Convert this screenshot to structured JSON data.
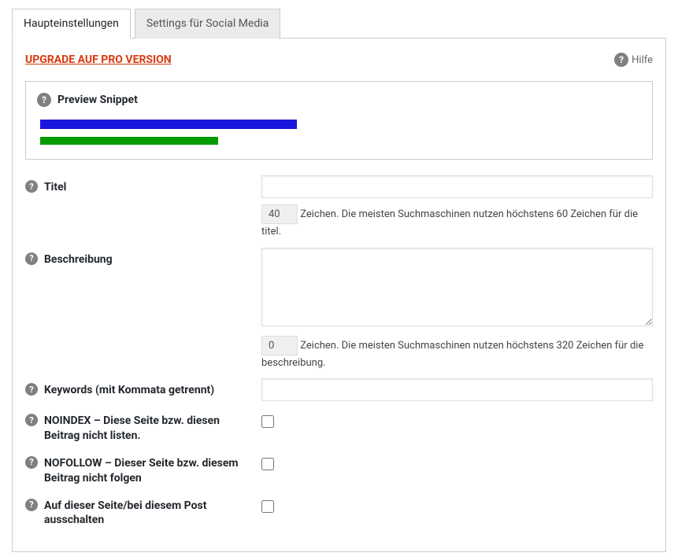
{
  "tabs": {
    "items": [
      {
        "label": "Haupteinstellungen",
        "active": true
      },
      {
        "label": "Settings für Social Media",
        "active": false
      }
    ]
  },
  "top": {
    "upgrade_label": "UPGRADE AUF PRO VERSION",
    "help_label": "Hilfe"
  },
  "preview": {
    "heading": "Preview Snippet"
  },
  "fields": {
    "title": {
      "label": "Titel",
      "value": "",
      "count": "40",
      "hint": "Zeichen. Die meisten Suchmaschinen nutzen höchstens 60 Zeichen für die titel."
    },
    "description": {
      "label": "Beschreibung",
      "value": "",
      "count": "0",
      "hint": "Zeichen. Die meisten Suchmaschinen nutzen höchstens 320 Zeichen für die beschreibung."
    },
    "keywords": {
      "label": "Keywords (mit Kommata getrennt)",
      "value": ""
    },
    "noindex": {
      "label": "NOINDEX – Diese Seite bzw. diesen Beitrag nicht listen."
    },
    "nofollow": {
      "label": "NOFOLLOW – Dieser Seite bzw. diesem Beitrag nicht folgen"
    },
    "disable": {
      "label": "Auf dieser Seite/bei diesem Post ausschalten"
    }
  }
}
